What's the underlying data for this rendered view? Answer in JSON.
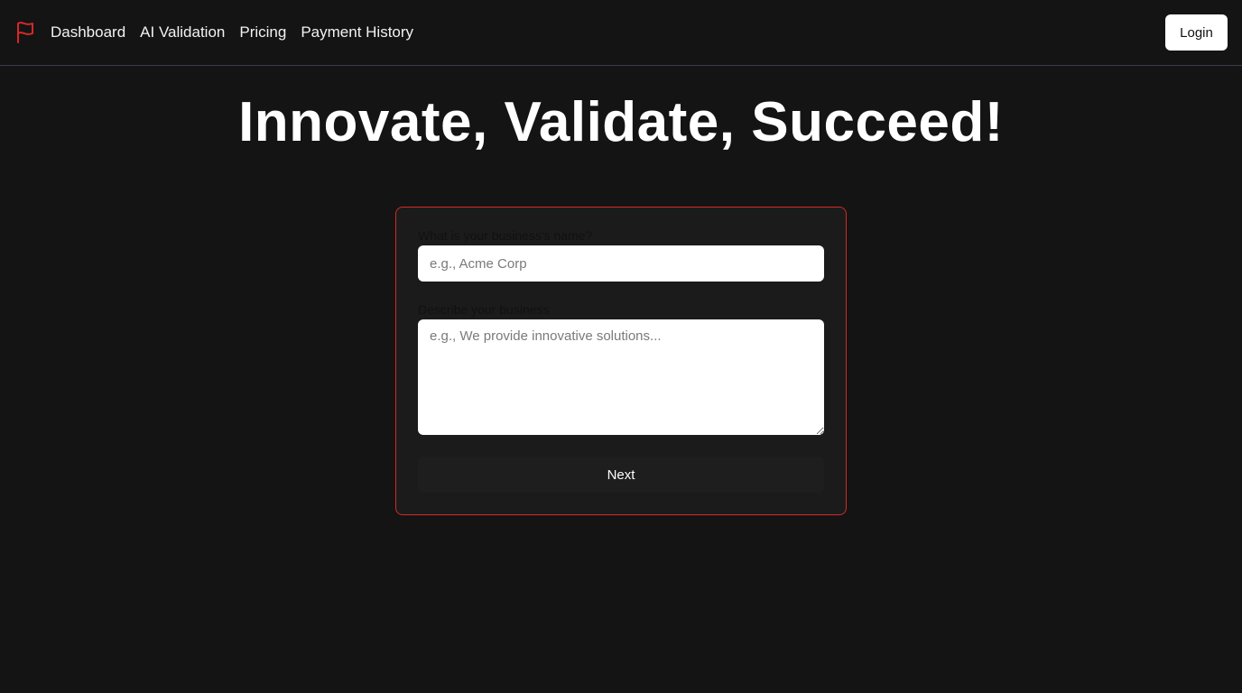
{
  "colors": {
    "background": "#141414",
    "accent": "#d62828",
    "card": "#1b1b1b",
    "text": "#ffffff"
  },
  "header": {
    "logo_icon": "flag-icon",
    "nav": [
      {
        "label": "Dashboard"
      },
      {
        "label": "AI Validation"
      },
      {
        "label": "Pricing"
      },
      {
        "label": "Payment History"
      }
    ],
    "login_label": "Login"
  },
  "hero": {
    "title": "Innovate, Validate, Succeed!"
  },
  "form": {
    "name_label": "What is your business's name?",
    "name_placeholder": "e.g., Acme Corp",
    "name_value": "",
    "desc_label": "Describe your business",
    "desc_placeholder": "e.g., We provide innovative solutions...",
    "desc_value": "",
    "next_label": "Next"
  }
}
